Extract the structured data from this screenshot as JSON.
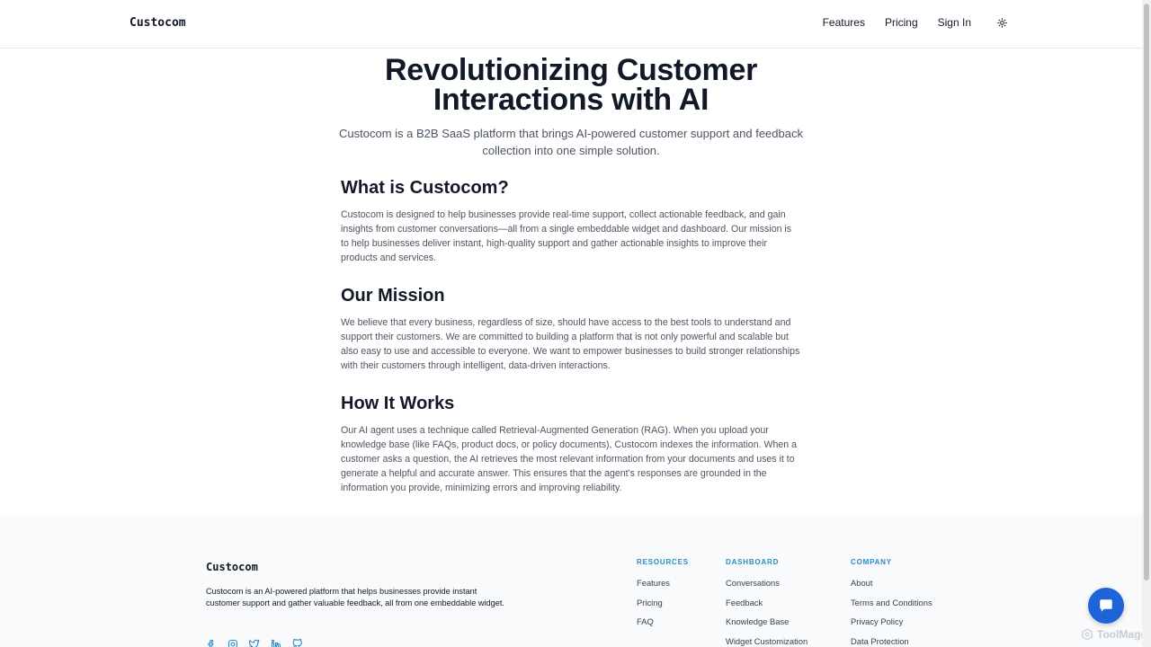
{
  "header": {
    "brand": "Custocom",
    "nav": {
      "features": "Features",
      "pricing": "Pricing",
      "sign_in": "Sign In"
    },
    "theme_icon": "sun-icon"
  },
  "hero": {
    "title": "Revolutionizing Customer Interactions with AI",
    "subtitle": "Custocom is a B2B SaaS platform that brings AI-powered customer support and feedback collection into one simple solution."
  },
  "sections": [
    {
      "heading": "What is Custocom?",
      "body": "Custocom is designed to help businesses provide real-time support, collect actionable feedback, and gain insights from customer conversations—all from a single embeddable widget and dashboard. Our mission is to help businesses deliver instant, high-quality support and gather actionable insights to improve their products and services."
    },
    {
      "heading": "Our Mission",
      "body": "We believe that every business, regardless of size, should have access to the best tools to understand and support their customers. We are committed to building a platform that is not only powerful and scalable but also easy to use and accessible to everyone. We want to empower businesses to build stronger relationships with their customers through intelligent, data-driven interactions."
    },
    {
      "heading": "How It Works",
      "body": "Our AI agent uses a technique called Retrieval-Augmented Generation (RAG). When you upload your knowledge base (like FAQs, product docs, or policy documents), Custocom indexes the information. When a customer asks a question, the AI retrieves the most relevant information from your documents and uses it to generate a helpful and accurate answer. This ensures that the agent's responses are grounded in the information you provide, minimizing errors and improving reliability."
    }
  ],
  "footer": {
    "brand": "Custocom",
    "description": "Custocom is an AI-powered platform that helps businesses provide instant customer support and gather valuable feedback, all from one embeddable widget.",
    "social_icons": [
      "facebook-icon",
      "instagram-icon",
      "twitter-icon",
      "linkedin-icon",
      "github-icon"
    ],
    "columns": [
      {
        "title": "RESOURCES",
        "links": [
          "Features",
          "Pricing",
          "FAQ"
        ]
      },
      {
        "title": "DASHBOARD",
        "links": [
          "Conversations",
          "Feedback",
          "Knowledge Base",
          "Widget Customization"
        ]
      },
      {
        "title": "COMPANY",
        "links": [
          "About",
          "Terms and Conditions",
          "Privacy Policy",
          "Data Protection"
        ]
      }
    ]
  },
  "chat_icon": "chat-bubble-icon",
  "watermark": "ToolMage",
  "colors": {
    "accent_blue": "#1d64d8",
    "footer_heading": "#2b8bc6",
    "footer_bg": "#f9fafb"
  }
}
